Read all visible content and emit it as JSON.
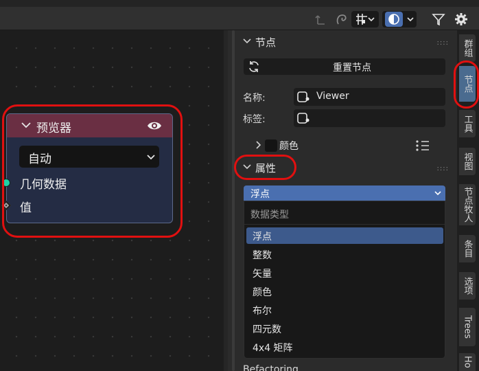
{
  "header": {
    "icons": [
      "parent-node-icon",
      "link-icon",
      "snap-grid-icon",
      "overlay-icon",
      "filter-icon",
      "gear-icon"
    ]
  },
  "node": {
    "title": "预览器",
    "domain_value": "自动",
    "sockets": [
      "几何数据",
      "值"
    ],
    "header_color": "#6a2f43",
    "geometry_socket_color": "#1fd2a5"
  },
  "sidebar": {
    "node_panel": {
      "title": "节点",
      "reset_label": "重置节点",
      "name_label": "名称:",
      "name_value": "Viewer",
      "label_label": "标签:",
      "label_value": "",
      "color_label": "颜色"
    },
    "properties_panel": {
      "title": "属性",
      "data_type_value": "浮点",
      "menu_title": "数据类型",
      "options": [
        "浮点",
        "整数",
        "矢量",
        "颜色",
        "布尔",
        "四元数",
        "4x4 矩阵"
      ],
      "selected_index": 0,
      "behind_text": "Befactoring"
    }
  },
  "tabs": [
    "群组",
    "节点",
    "工具",
    "视图",
    "节点牧人",
    "条目",
    "选项",
    "Trees",
    "Ho"
  ],
  "active_tab": "节点",
  "colors": {
    "accent": "#4a6fb0",
    "annotation": "#e11010"
  }
}
